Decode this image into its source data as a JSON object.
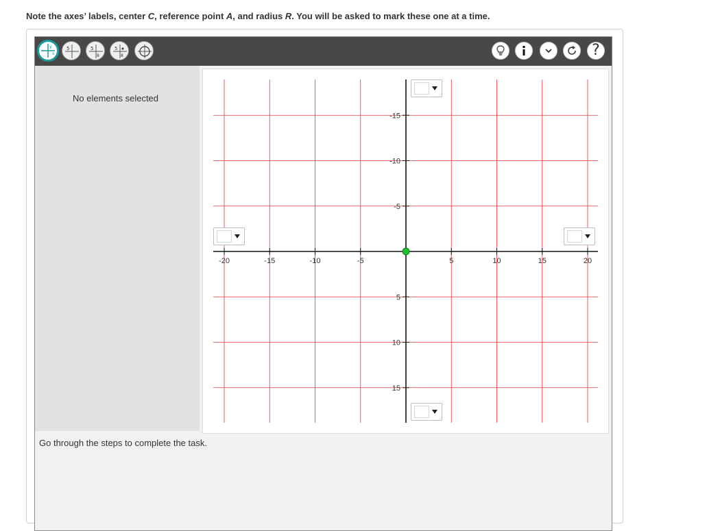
{
  "instruction": {
    "part1": "Note the axes’ labels, center ",
    "c": "C",
    "part2": ", reference point ",
    "a": "A",
    "part3": ", and radius ",
    "r": "R",
    "part4": ". You will be asked to mark these one at a time."
  },
  "toolbar": {
    "tools": [
      "axes-tool",
      "label-x-tool",
      "label-y-tool",
      "center-tool",
      "circle-tool"
    ],
    "right_buttons": [
      "hint",
      "info",
      "collapse",
      "reset",
      "help"
    ],
    "help_label": "?"
  },
  "side_panel": {
    "empty_text": "No elements selected"
  },
  "status": {
    "text": "Go through the steps to complete the task."
  },
  "graph": {
    "x_ticks": [
      "-20",
      "-15",
      "-10",
      "-5",
      "5",
      "10",
      "15",
      "20"
    ],
    "y_ticks_top": [
      "-15",
      "-10",
      "-5"
    ],
    "y_ticks_bottom": [
      "5",
      "10",
      "15"
    ],
    "x_range": [
      -20,
      20
    ],
    "y_range": [
      -15,
      15
    ],
    "grid_color": "#e5393b",
    "origin_point_color": "#22c02a"
  }
}
